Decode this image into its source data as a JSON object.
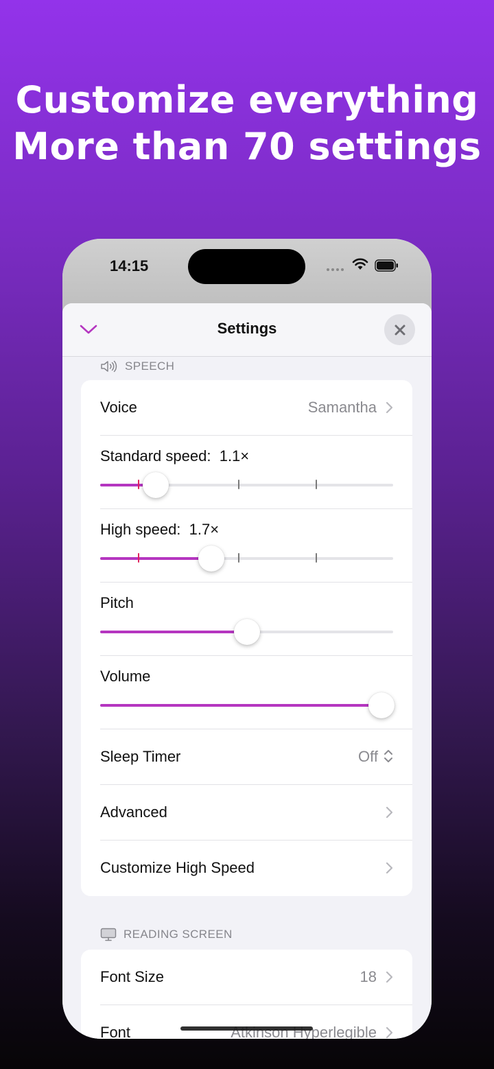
{
  "promo": {
    "line1": "Customize everything",
    "line2": "More than 70 settings"
  },
  "status_bar": {
    "time": "14:15",
    "icons": [
      "signal-icon",
      "wifi-icon",
      "battery-icon"
    ]
  },
  "nav": {
    "title": "Settings",
    "collapse_icon": "chevron-down-icon",
    "close_icon": "close-icon"
  },
  "speech": {
    "header": "SPEECH",
    "voice": {
      "label": "Voice",
      "value": "Samantha"
    },
    "standard_speed": {
      "label": "Standard speed:",
      "value": "1.1×",
      "fraction": 0.19
    },
    "high_speed": {
      "label": "High speed:",
      "value": "1.7×",
      "fraction": 0.38
    },
    "pitch": {
      "label": "Pitch",
      "fraction": 0.5
    },
    "volume": {
      "label": "Volume",
      "fraction": 0.96
    },
    "sleep_timer": {
      "label": "Sleep Timer",
      "value": "Off"
    },
    "advanced": {
      "label": "Advanced"
    },
    "customize_high_speed": {
      "label": "Customize High Speed"
    }
  },
  "reading_screen": {
    "header": "READING SCREEN",
    "font_size": {
      "label": "Font Size",
      "value": "18"
    },
    "font": {
      "label": "Font",
      "value": "Atkinson Hyperlegible"
    }
  },
  "colors": {
    "accent": "#b536c0",
    "tick_marker": "#e0245e",
    "background_top": "#9333ea",
    "background_bottom": "#070507"
  }
}
